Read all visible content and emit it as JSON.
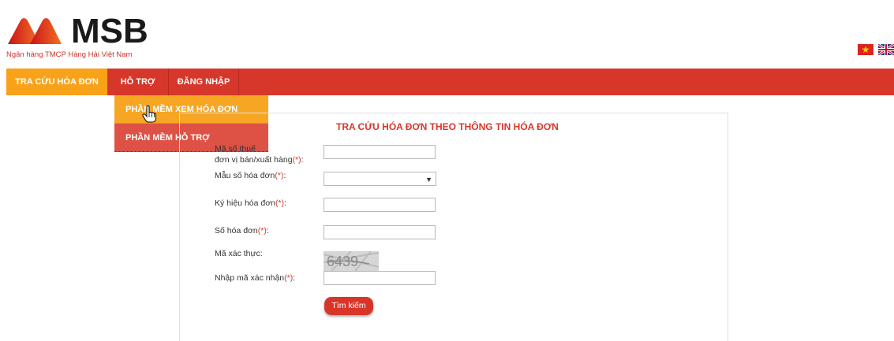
{
  "brand": {
    "logo_text": "MSB",
    "subtitle": "Ngân hàng TMCP Hàng Hải Việt Nam"
  },
  "languages": [
    {
      "name": "vietnam-flag-icon"
    },
    {
      "name": "uk-flag-icon"
    }
  ],
  "nav": {
    "items": [
      {
        "label": "TRA CỨU HÓA ĐƠN",
        "active": true
      },
      {
        "label": "HỖ TRỢ",
        "active": false
      },
      {
        "label": "ĐĂNG NHẬP",
        "active": false
      }
    ],
    "dropdown": [
      {
        "label": "PHẦN MỀM XEM HÓA ĐƠN",
        "highlighted": true
      },
      {
        "label": "PHẦN MỀM HỖ TRỢ",
        "highlighted": false
      }
    ]
  },
  "form": {
    "title": "TRA CỨU HÓA ĐƠN THEO THÔNG TIN HÓA ĐƠN",
    "tax_code_label_1": "Mã số thuế",
    "tax_code_label_2": "đơn vị bán/xuất hàng",
    "template_label": "Mẫu số hóa đơn",
    "symbol_label": "Ký hiệu hóa đơn",
    "number_label": "Số hóa đơn",
    "captcha_label": "Mã xác thực:",
    "captcha_input_label": "Nhập mã xác nhận",
    "required_mark": "(*)",
    "colon": ":",
    "captcha_code": "6439",
    "search_button": "Tìm kiếm"
  },
  "colors": {
    "brand_red": "#d7372a",
    "active_orange": "#f8a21a"
  }
}
